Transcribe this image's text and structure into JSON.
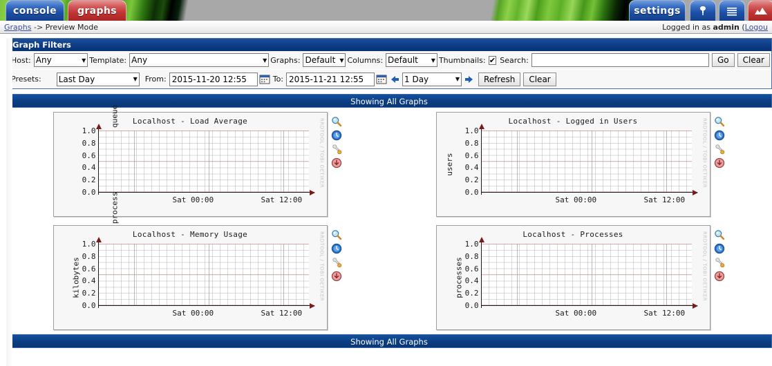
{
  "topnav": {
    "tabs": [
      {
        "label": "console",
        "name": "tab-console",
        "style": "blue"
      },
      {
        "label": "graphs",
        "name": "tab-graphs",
        "style": "red"
      },
      {
        "label": "settings",
        "name": "tab-settings",
        "style": "blue"
      }
    ],
    "icon_tabs": [
      {
        "icon": "tree-icon",
        "name": "tab-tree-view"
      },
      {
        "icon": "list-icon",
        "name": "tab-list-view"
      },
      {
        "icon": "graph-preview-icon",
        "name": "tab-preview-view"
      }
    ]
  },
  "breadcrumb": {
    "root": "Graphs",
    "separator": "->",
    "current": "Preview Mode"
  },
  "session": {
    "prefix": "Logged in as ",
    "user": "admin",
    "paren_open": " (",
    "logout": "Logou"
  },
  "filters": {
    "title": "Graph Filters",
    "host_label": "Host:",
    "host_value": "Any",
    "template_label": "Template:",
    "template_value": "Any",
    "graphs_label": "Graphs:",
    "graphs_value": "Default",
    "columns_label": "Columns:",
    "columns_value": "Default",
    "thumbnails_label": "Thumbnails:",
    "thumbnails_checked": "✔",
    "search_label": "Search:",
    "search_value": "",
    "search_placeholder": "",
    "go_label": "Go",
    "clear_label": "Clear",
    "presets_label": "Presets:",
    "presets_value": "Last Day",
    "from_label": "From:",
    "from_value": "2015-11-20 12:55",
    "to_label": "To:",
    "to_value": "2015-11-21 12:55",
    "span_value": "1 Day",
    "refresh_label": "Refresh",
    "clear2_label": "Clear",
    "calendar_icon": "calendar-icon",
    "prev_arrow_icon": "arrow-left-icon",
    "next_arrow_icon": "arrow-right-icon"
  },
  "showing_top": "Showing All Graphs",
  "showing_bottom": "Showing All Graphs",
  "graph_icons": [
    {
      "name": "graph-zoom-icon",
      "title": "zoom"
    },
    {
      "name": "graph-realtime-icon",
      "title": "realtime"
    },
    {
      "name": "graph-properties-icon",
      "title": "properties"
    },
    {
      "name": "graph-csv-export-icon",
      "title": "export"
    }
  ],
  "chart_data": [
    {
      "type": "line",
      "title": "Localhost - Load Average",
      "ylabel": "processes in the run queue",
      "xlabel": "",
      "yticks": [
        "1.0",
        "0.8",
        "0.6",
        "0.4",
        "0.2",
        "0.0"
      ],
      "ylim": [
        0.0,
        1.0
      ],
      "xticks": [
        "Sat 00:00",
        "Sat 12:00"
      ],
      "series": [],
      "grid": true,
      "legend": "none",
      "watermark": "RRDTOOL / TOBI OETIKER"
    },
    {
      "type": "line",
      "title": "Localhost - Logged in Users",
      "ylabel": "users",
      "xlabel": "",
      "yticks": [
        "1.0",
        "0.8",
        "0.6",
        "0.4",
        "0.2",
        "0.0"
      ],
      "ylim": [
        0.0,
        1.0
      ],
      "xticks": [
        "Sat 00:00",
        "Sat 12:00"
      ],
      "series": [],
      "grid": true,
      "legend": "none",
      "watermark": "RRDTOOL / TOBI OETIKER"
    },
    {
      "type": "line",
      "title": "Localhost - Memory Usage",
      "ylabel": "kilobytes",
      "xlabel": "",
      "yticks": [
        "1.0",
        "0.8",
        "0.6",
        "0.4",
        "0.2",
        "0.0"
      ],
      "ylim": [
        0.0,
        1.0
      ],
      "xticks": [
        "Sat 00:00",
        "Sat 12:00"
      ],
      "series": [],
      "grid": true,
      "legend": "none",
      "watermark": "RRDTOOL / TOBI OETIKER"
    },
    {
      "type": "line",
      "title": "Localhost - Processes",
      "ylabel": "processes",
      "xlabel": "",
      "yticks": [
        "1.0",
        "0.8",
        "0.6",
        "0.4",
        "0.2",
        "0.0"
      ],
      "ylim": [
        0.0,
        1.0
      ],
      "xticks": [
        "Sat 00:00",
        "Sat 12:00"
      ],
      "series": [],
      "grid": true,
      "legend": "none",
      "watermark": "RRDTOOL / TOBI OETIKER"
    }
  ],
  "colors": {
    "header_blue": "#0b3b84",
    "tab_red": "#c23434",
    "link": "#3b4fa0",
    "panel_bg": "#f7f7f7"
  }
}
